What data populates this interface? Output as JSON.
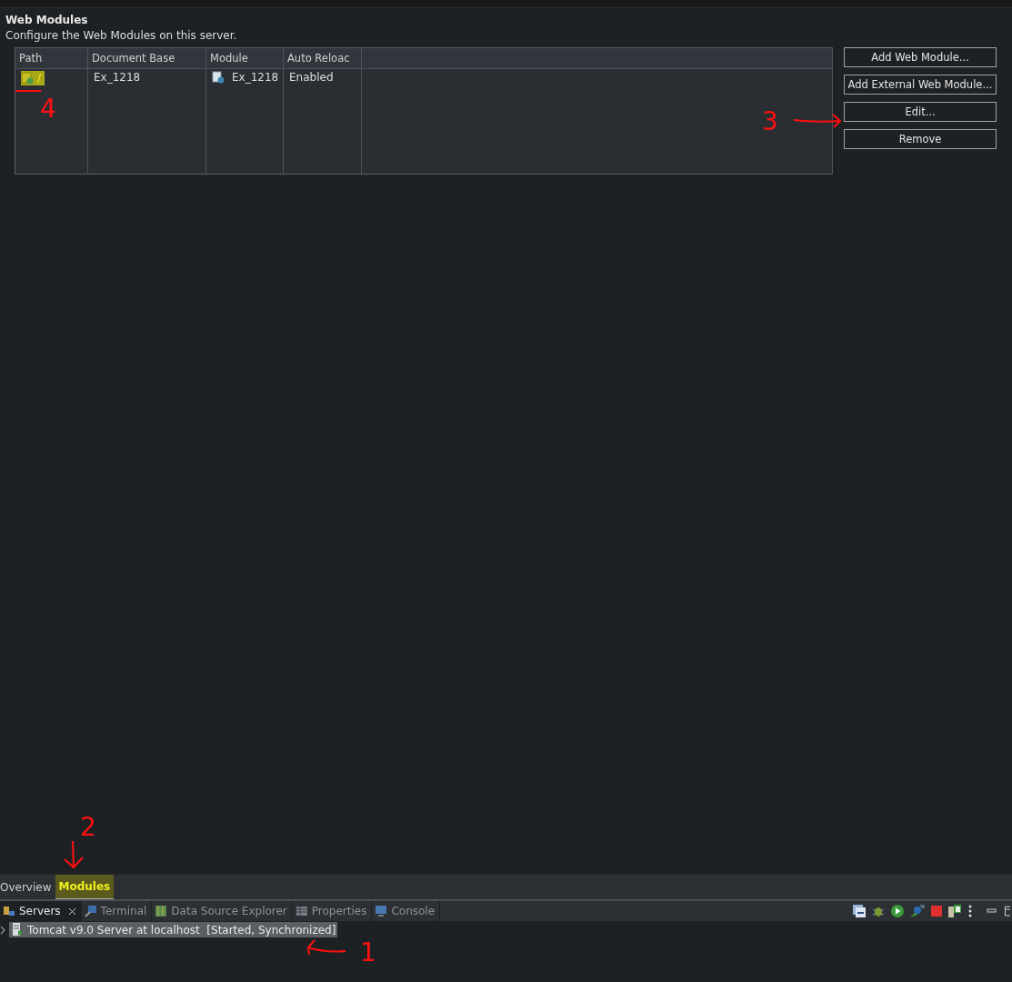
{
  "section": {
    "title": "Web Modules",
    "description": "Configure the Web Modules on this server."
  },
  "table": {
    "columns": [
      "Path",
      "Document Base",
      "Module",
      "Auto Reloac"
    ],
    "rows": [
      {
        "path": "/",
        "path_highlighted": true,
        "document_base": "Ex_1218",
        "module": "Ex_1218",
        "auto_reload": "Enabled"
      }
    ]
  },
  "buttons": [
    "Add Web Module...",
    "Add External Web Module...",
    "Edit...",
    "Remove"
  ],
  "editor_tabs": [
    {
      "label": "Overview",
      "selected": false,
      "highlighted": false
    },
    {
      "label": "Modules",
      "selected": true,
      "highlighted": true
    }
  ],
  "view_tabs": [
    {
      "label": "Servers",
      "selected": true
    },
    {
      "label": "Terminal",
      "selected": false
    },
    {
      "label": "Data Source Explorer",
      "selected": false
    },
    {
      "label": "Properties",
      "selected": false
    },
    {
      "label": "Console",
      "selected": false
    }
  ],
  "servers": [
    {
      "name": "Tomcat v9.0 Server at localhost  [Started, Synchronized]",
      "selected": true,
      "expanded": false
    }
  ],
  "annotations": [
    {
      "label": "4",
      "kind": "underline"
    },
    {
      "label": "3",
      "kind": "right"
    },
    {
      "label": "2",
      "kind": "down"
    },
    {
      "label": "1",
      "kind": "left"
    }
  ]
}
